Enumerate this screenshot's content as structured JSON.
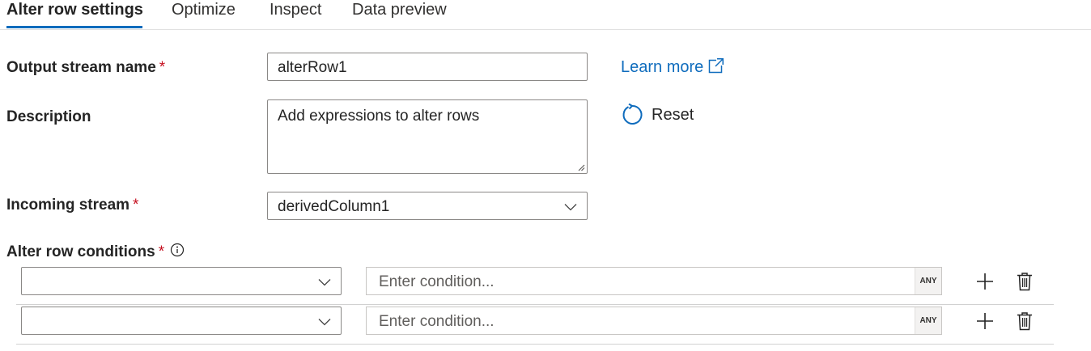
{
  "tabs": [
    {
      "label": "Alter row settings",
      "active": true
    },
    {
      "label": "Optimize",
      "active": false
    },
    {
      "label": "Inspect",
      "active": false
    },
    {
      "label": "Data preview",
      "active": false
    }
  ],
  "fields": {
    "output_stream": {
      "label": "Output stream name",
      "required_mark": "*",
      "value": "alterRow1"
    },
    "description": {
      "label": "Description",
      "value": "Add expressions to alter rows"
    },
    "incoming_stream": {
      "label": "Incoming stream",
      "required_mark": "*",
      "value": "derivedColumn1"
    },
    "alter_conditions": {
      "label": "Alter row conditions",
      "required_mark": "*"
    }
  },
  "actions": {
    "learn_more": "Learn more",
    "reset": "Reset"
  },
  "conditions": [
    {
      "type_value": "",
      "expression_placeholder": "Enter condition...",
      "badge": "ANY"
    },
    {
      "type_value": "",
      "expression_placeholder": "Enter condition...",
      "badge": "ANY"
    }
  ],
  "colors": {
    "accent": "#0f6cbd",
    "required": "#c50f1f"
  }
}
